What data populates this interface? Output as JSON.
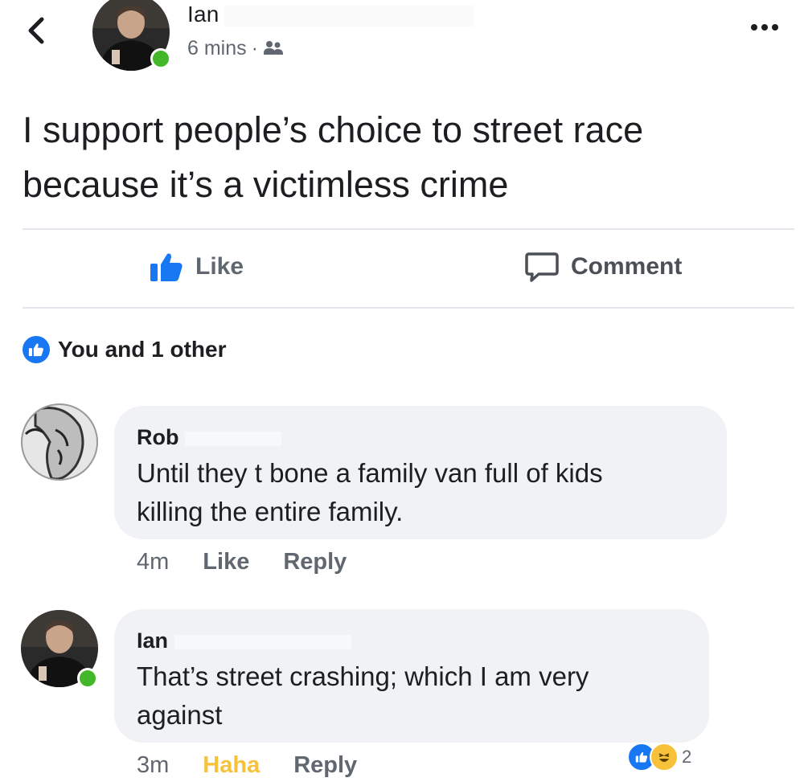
{
  "header": {
    "poster_name": "Ian",
    "post_time": "6 mins",
    "separator": "·",
    "audience_icon": "friends-icon",
    "back_icon": "chevron-left-icon",
    "more_icon": "more-dots-icon"
  },
  "post": {
    "text_line1": "I support people’s choice to street race",
    "text_line2": "because it’s a victimless crime"
  },
  "actions": {
    "like_label": "Like",
    "comment_label": "Comment"
  },
  "reactions": {
    "summary": "You and 1 other"
  },
  "comments": [
    {
      "name": "Rob",
      "text_line1": "Until they t bone a family van full of kids",
      "text_line2": "killing the entire family.",
      "time": "4m",
      "action1": "Like",
      "action2": "Reply"
    },
    {
      "name": "Ian",
      "text_line1": "That’s street crashing; which I am very",
      "text_line2": "against",
      "time": "3m",
      "action1": "Haha",
      "action2": "Reply",
      "reaction_count": "2"
    }
  ],
  "colors": {
    "accent": "#1877f2",
    "online": "#42b72a",
    "haha": "#f7c23a",
    "bubble": "#f0f2f5",
    "muted": "#606770"
  }
}
